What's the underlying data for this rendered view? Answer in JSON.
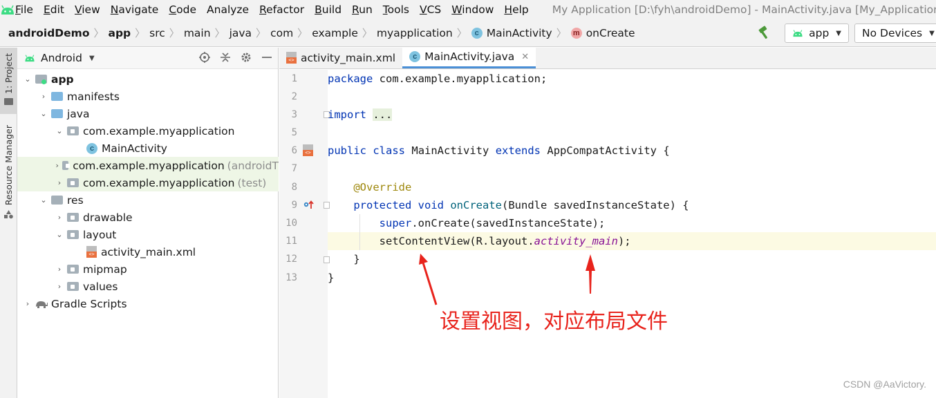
{
  "menubar": {
    "items": [
      {
        "mn": "F",
        "rest": "ile"
      },
      {
        "mn": "E",
        "rest": "dit"
      },
      {
        "mn": "V",
        "rest": "iew"
      },
      {
        "mn": "N",
        "rest": "avigate"
      },
      {
        "mn": "C",
        "rest": "ode"
      },
      {
        "mn": "",
        "rest": "Analyze"
      },
      {
        "mn": "R",
        "rest": "efactor"
      },
      {
        "mn": "B",
        "rest": "uild"
      },
      {
        "mn": "R",
        "rest": "un"
      },
      {
        "mn": "T",
        "rest": "ools"
      },
      {
        "mn": "V",
        "rest": "CS"
      },
      {
        "mn": "W",
        "rest": "indow"
      },
      {
        "mn": "H",
        "rest": "elp"
      }
    ],
    "window_title": "My Application [D:\\fyh\\androidDemo] - MainActivity.java [My_Application.ap"
  },
  "breadcrumb": {
    "project": "androidDemo",
    "module": "app",
    "p1": "src",
    "p2": "main",
    "p3": "java",
    "p4": "com",
    "p5": "example",
    "p6": "myapplication",
    "cls": "MainActivity",
    "method": "onCreate"
  },
  "toolbar": {
    "config": "app",
    "devices": "No Devices"
  },
  "sidestrip": {
    "project_tab": "1: Project",
    "resource_tab": "Resource Manager"
  },
  "project_panel": {
    "view": "Android",
    "tree": {
      "app": "app",
      "manifests": "manifests",
      "java": "java",
      "pkg1": "com.example.myapplication",
      "main_activity": "MainActivity",
      "pkg2": "com.example.myapplication",
      "pkg2_suffix": "(androidT",
      "pkg3": "com.example.myapplication",
      "pkg3_suffix": "(test)",
      "res": "res",
      "drawable": "drawable",
      "layout": "layout",
      "activity_main": "activity_main.xml",
      "mipmap": "mipmap",
      "values": "values",
      "gradle": "Gradle Scripts"
    }
  },
  "editor": {
    "tabs": {
      "xml": "activity_main.xml",
      "java": "MainActivity.java"
    },
    "line_numbers": [
      "1",
      "2",
      "3",
      "5",
      "6",
      "7",
      "8",
      "9",
      "10",
      "11",
      "12",
      "13"
    ],
    "code": {
      "l1_kw": "package",
      "l1_rest": " com.example.myapplication;",
      "l3_kw": "import",
      "l3_fold": "...",
      "l6_kw1": "public",
      "l6_kw2": "class",
      "l6_name": "MainActivity",
      "l6_kw3": "extends",
      "l6_rest": "AppCompatActivity {",
      "l8_ann": "@Override",
      "l9_kw1": "protected",
      "l9_kw2": "void",
      "l9_fn": "onCreate",
      "l9_rest": "(Bundle savedInstanceState) {",
      "l10_kw": "super",
      "l10_rest": ".onCreate(savedInstanceState);",
      "l11_a": "setContentView(R.layout.",
      "l11_itl": "activity_main",
      "l11_b": ");",
      "l12": "}",
      "l13": "}"
    }
  },
  "annotation_text": "设置视图，对应布局文件",
  "watermark": "CSDN @AaVictory.",
  "colors": {
    "annotation": "#e8231c",
    "keyword": "#0033b3",
    "annotation_code": "#9e880d",
    "method": "#00627a",
    "field_italic": "#871094"
  }
}
